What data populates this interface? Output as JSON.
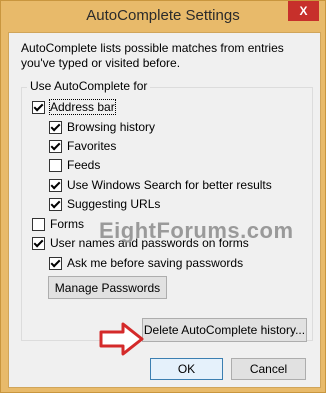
{
  "window": {
    "title": "AutoComplete Settings",
    "close_glyph": "X"
  },
  "description": "AutoComplete lists possible matches from entries you've typed or visited before.",
  "group": {
    "label": "Use AutoComplete for"
  },
  "options": {
    "address_bar": {
      "label": "Address bar",
      "checked": true
    },
    "browsing_history": {
      "label": "Browsing history",
      "checked": true
    },
    "favorites": {
      "label": "Favorites",
      "checked": true
    },
    "feeds": {
      "label": "Feeds",
      "checked": false
    },
    "windows_search": {
      "label": "Use Windows Search for better results",
      "checked": true
    },
    "suggesting_urls": {
      "label": "Suggesting URLs",
      "checked": true
    },
    "forms": {
      "label": "Forms",
      "checked": false
    },
    "user_names": {
      "label": "User names and passwords on forms",
      "checked": true
    },
    "ask_before_saving": {
      "label": "Ask me before saving passwords",
      "checked": true
    }
  },
  "buttons": {
    "manage_passwords": "Manage Passwords",
    "delete_history": "Delete AutoComplete history...",
    "ok": "OK",
    "cancel": "Cancel"
  },
  "watermark": "EightForums.com",
  "colors": {
    "frame": "#e8ba6a",
    "close": "#c7302b",
    "arrow": "#d42a2a"
  }
}
